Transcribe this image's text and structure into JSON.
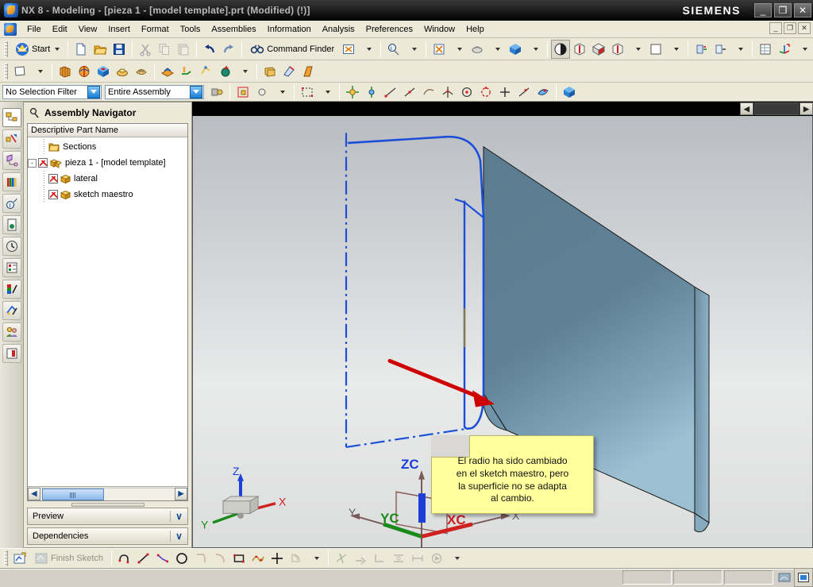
{
  "window": {
    "title": "NX 8 - Modeling - [pieza 1 - [model template].prt (Modified)    (!)]",
    "brand": "SIEMENS",
    "minimize": "_",
    "maximize": "❐",
    "close": "✕",
    "app_icon": "nx-logo-icon"
  },
  "menubar": {
    "items": [
      {
        "label": "File"
      },
      {
        "label": "Edit"
      },
      {
        "label": "View"
      },
      {
        "label": "Insert"
      },
      {
        "label": "Format"
      },
      {
        "label": "Tools"
      },
      {
        "label": "Assemblies"
      },
      {
        "label": "Information"
      },
      {
        "label": "Analysis"
      },
      {
        "label": "Preferences"
      },
      {
        "label": "Window"
      },
      {
        "label": "Help"
      }
    ],
    "mdi": {
      "minimize": "_",
      "restore": "❐",
      "close": "✕"
    }
  },
  "toolbar_standard": {
    "start_label": "Start",
    "command_finder_label": "Command Finder",
    "buttons": [
      {
        "name": "start-menu-button",
        "label": "Start"
      },
      {
        "name": "new-file-button",
        "icon": "new-document-icon"
      },
      {
        "name": "open-file-button",
        "icon": "open-folder-icon"
      },
      {
        "name": "save-button",
        "icon": "floppy-disk-icon"
      },
      {
        "name": "cut-button",
        "icon": "scissors-icon"
      },
      {
        "name": "copy-button",
        "icon": "copy-icon"
      },
      {
        "name": "paste-button",
        "icon": "paste-icon"
      },
      {
        "name": "undo-button",
        "icon": "undo-arrow-icon"
      },
      {
        "name": "redo-button",
        "icon": "redo-arrow-icon"
      },
      {
        "name": "command-finder-button",
        "icon": "binoculars-icon"
      }
    ]
  },
  "selection_bar": {
    "filter": {
      "value": "No Selection Filter"
    },
    "scope": {
      "value": "Entire Assembly"
    }
  },
  "navigator": {
    "title": "Assembly Navigator",
    "column_header": "Descriptive Part Name",
    "rows": [
      {
        "label": "Sections",
        "icon": "folder-icon",
        "depth": 1,
        "checkbox": "none",
        "expander": ""
      },
      {
        "label": "pieza 1 - [model template]",
        "icon": "assembly-icon",
        "depth": 0,
        "checkbox": "checked",
        "expander": "-"
      },
      {
        "label": "lateral",
        "icon": "part-icon",
        "depth": 1,
        "checkbox": "checked",
        "expander": ""
      },
      {
        "label": "sketch maestro",
        "icon": "part-icon",
        "depth": 1,
        "checkbox": "checked",
        "expander": ""
      }
    ],
    "scroll": {
      "left_arrow": "◀",
      "right_arrow": "▶"
    },
    "panels": [
      {
        "label": "Preview",
        "chevron": "∨"
      },
      {
        "label": "Dependencies",
        "chevron": "∨"
      }
    ]
  },
  "resource_bar": {
    "items": [
      {
        "name": "assembly-navigator-icon",
        "active": true
      },
      {
        "name": "constraint-navigator-icon",
        "active": false
      },
      {
        "name": "part-navigator-icon",
        "active": false
      },
      {
        "name": "reuse-library-icon",
        "active": false
      },
      {
        "name": "hd3d-tools-icon",
        "active": false
      },
      {
        "name": "web-browser-icon",
        "active": false
      },
      {
        "name": "history-icon",
        "active": false
      },
      {
        "name": "process-studio-icon",
        "active": false
      },
      {
        "name": "roles-icon",
        "active": false
      },
      {
        "name": "system-scenes-icon",
        "active": false
      },
      {
        "name": "collaboration-icon",
        "active": false
      },
      {
        "name": "full-screen-icon",
        "active": false
      }
    ]
  },
  "graphics": {
    "note": {
      "lines": [
        "El radio ha sido cambiado",
        "en el sketch maestro, pero",
        "la superficie no se adapta",
        "al cambio."
      ],
      "text": "El radio ha sido cambiado en el sketch maestro, pero la superficie no se adapta al cambio.",
      "background": "#ffff9e",
      "border": "#b9b36a"
    },
    "arrow": {
      "name": "red-pointer-arrow",
      "color": "#d40000"
    },
    "wcs_triad": {
      "x_label": "XC",
      "y_label": "YC",
      "z_label": "ZC"
    },
    "view_triad": {
      "x_label": "X",
      "y_label": "Y",
      "z_label": "Z"
    },
    "colors": {
      "sketch_curve": "#1b4fd8",
      "surface_face": "#5d7d91",
      "surface_edge": "#1a1a1a"
    },
    "scroll": {
      "left_arrow": "◀",
      "right_arrow": "▶"
    }
  },
  "sketch_bar": {
    "finish_label": "Finish Sketch",
    "tools": [
      {
        "name": "sketch-in-task-env-icon"
      },
      {
        "name": "finish-sketch-icon"
      },
      {
        "name": "profile-tool-icon"
      },
      {
        "name": "line-tool-icon"
      },
      {
        "name": "polyline-tool-icon"
      },
      {
        "name": "circle-tool-icon"
      },
      {
        "name": "arc-tool-icon"
      },
      {
        "name": "fillet-tool-icon"
      },
      {
        "name": "rectangle-tool-icon"
      },
      {
        "name": "studio-spline-icon"
      },
      {
        "name": "point-tool-icon"
      },
      {
        "name": "offset-curve-icon"
      },
      {
        "name": "trim-recipe-icon"
      },
      {
        "name": "quick-trim-icon"
      },
      {
        "name": "quick-extend-icon"
      },
      {
        "name": "make-corner-icon"
      },
      {
        "name": "constraints-icon"
      },
      {
        "name": "dimension-icon"
      },
      {
        "name": "animate-dimension-icon"
      }
    ]
  },
  "status_bar": {
    "indicators": [
      {
        "name": "render-mode-indicator"
      },
      {
        "name": "display-mode-indicator"
      }
    ]
  }
}
